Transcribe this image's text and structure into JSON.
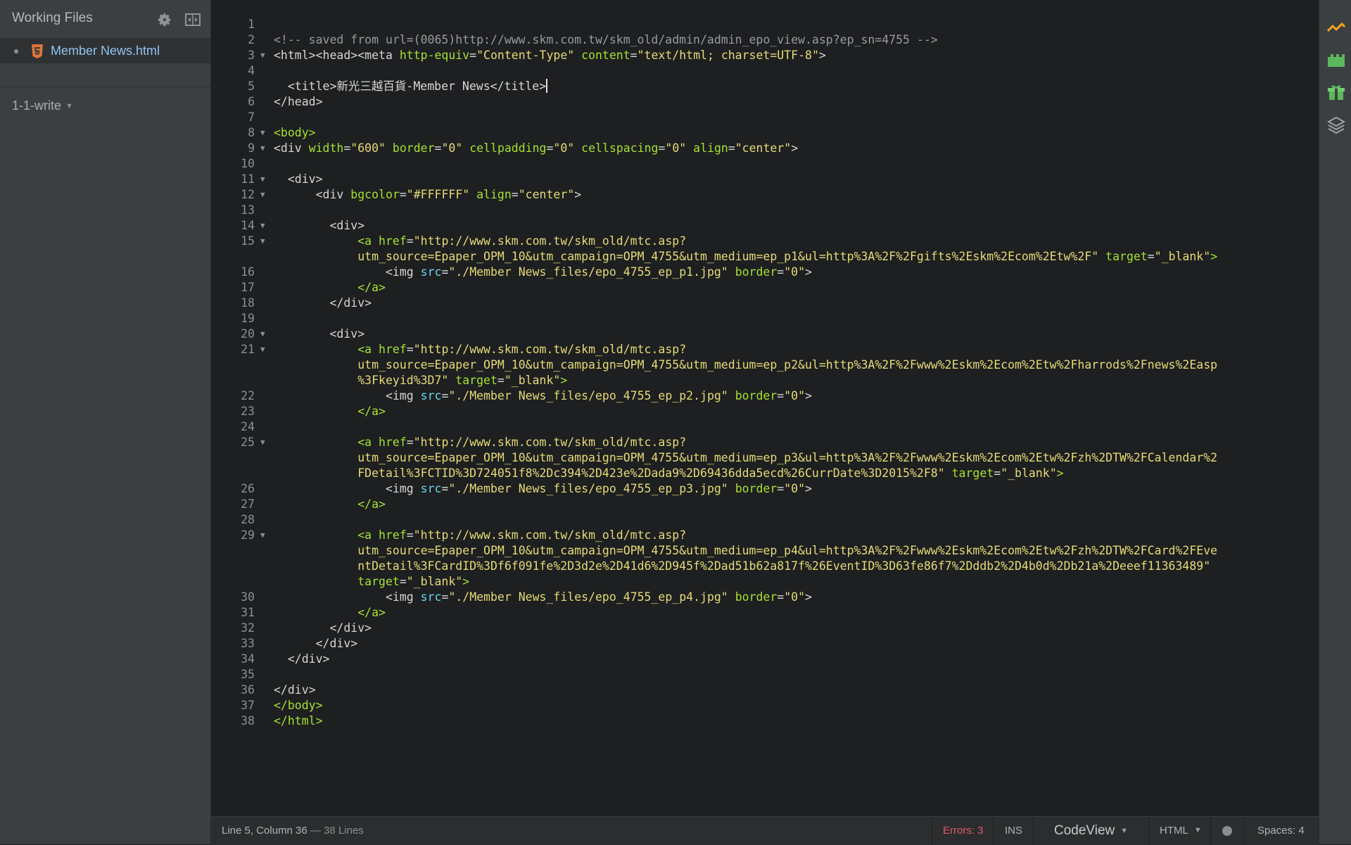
{
  "sidebar": {
    "title": "Working Files",
    "icons": {
      "settings": "gear-icon",
      "split": "split-view-icon"
    },
    "files": [
      {
        "name": "Member News.html",
        "icon": "html5-icon"
      }
    ],
    "project": "1-1-write"
  },
  "editor": {
    "lines": [
      {
        "n": "1"
      },
      {
        "n": "2"
      },
      {
        "n": "3"
      },
      {
        "n": "4"
      },
      {
        "n": "5"
      },
      {
        "n": "6"
      },
      {
        "n": "7"
      },
      {
        "n": "8"
      },
      {
        "n": "9"
      },
      {
        "n": "10"
      },
      {
        "n": "11"
      },
      {
        "n": "12"
      },
      {
        "n": "13"
      },
      {
        "n": "14"
      },
      {
        "n": "15"
      },
      {
        "n": "16"
      },
      {
        "n": "17"
      },
      {
        "n": "18"
      },
      {
        "n": "19"
      },
      {
        "n": "20"
      },
      {
        "n": "21"
      },
      {
        "n": "22"
      },
      {
        "n": "23"
      },
      {
        "n": "24"
      },
      {
        "n": "25"
      },
      {
        "n": "26"
      },
      {
        "n": "27"
      },
      {
        "n": "28"
      },
      {
        "n": "29"
      },
      {
        "n": "30"
      },
      {
        "n": "31"
      },
      {
        "n": "32"
      },
      {
        "n": "33"
      },
      {
        "n": "34"
      },
      {
        "n": "35"
      },
      {
        "n": "36"
      },
      {
        "n": "37"
      },
      {
        "n": "38"
      }
    ]
  },
  "status": {
    "position": "Line 5, Column 36",
    "lines_sep": " — ",
    "lines": "38 Lines",
    "errors": "Errors: 3",
    "mode": "INS",
    "view": "CodeView",
    "language": "HTML",
    "spaces": "Spaces:  4"
  },
  "colors": {
    "background": "#1d1f21",
    "sidebar": "#3c3f41",
    "tag_green": "#a6e22e",
    "string_yellow": "#e6db74",
    "attr_cyan": "#66d9ef",
    "error_red": "#e05c6c",
    "file_blue": "#8fc4f0"
  }
}
